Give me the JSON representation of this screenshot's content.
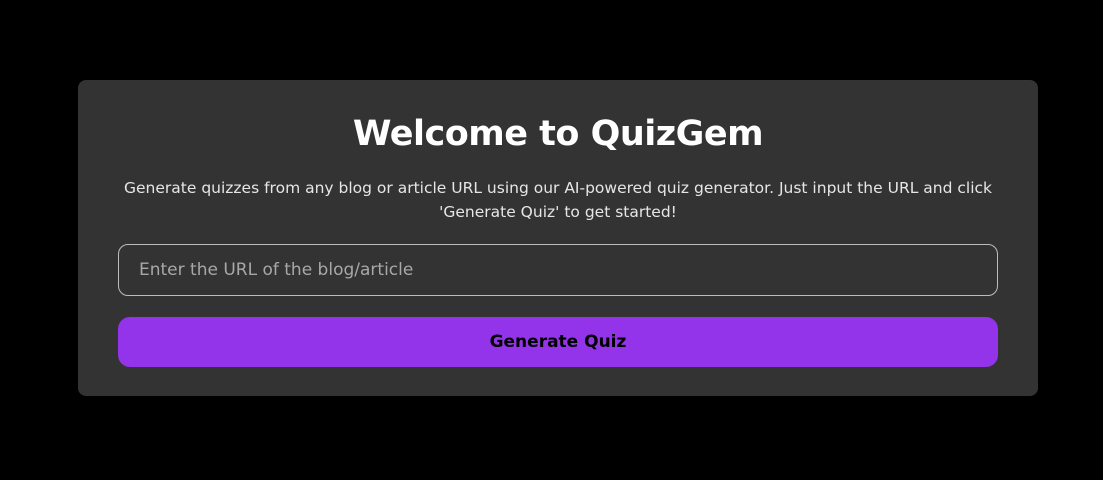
{
  "hero": {
    "title": "Welcome to QuizGem",
    "description": "Generate quizzes from any blog or article URL using our AI-powered quiz generator. Just input the URL and click 'Generate Quiz' to get started!"
  },
  "form": {
    "url_placeholder": "Enter the URL of the blog/article",
    "url_value": "",
    "submit_label": "Generate Quiz"
  },
  "colors": {
    "background": "#000000",
    "card": "#333333",
    "accent": "#9333ea",
    "text": "#ffffff"
  }
}
